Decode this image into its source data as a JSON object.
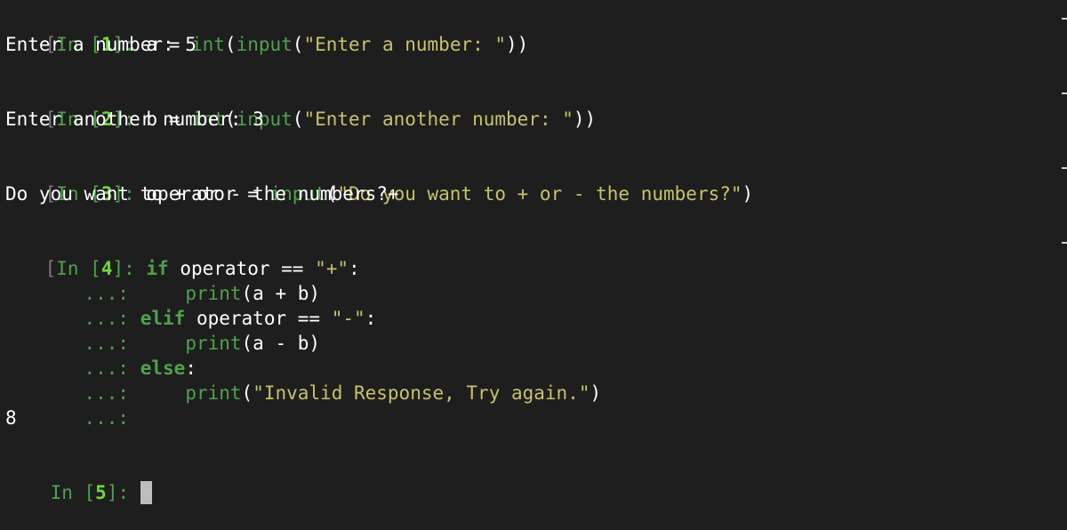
{
  "cell1": {
    "open": "[",
    "in": "In [",
    "n": "1",
    "close": "]: ",
    "v1": "a = ",
    "f1": "int",
    "p1": "(",
    "f2": "input",
    "p2": "(",
    "s1": "\"Enter a number: \"",
    "p3": "))",
    "output": "Enter a number: 5"
  },
  "cell2": {
    "open": "[",
    "in": "In [",
    "n": "2",
    "close": "]: ",
    "v1": "b = ",
    "f1": "int",
    "p1": "(",
    "f2": "input",
    "p2": "(",
    "s1": "\"Enter another number: \"",
    "p3": "))",
    "output": "Enter another number: 3"
  },
  "cell3": {
    "open": "[",
    "in": "In [",
    "n": "3",
    "close": "]: ",
    "v1": "operator = ",
    "f1": "input",
    "p1": "(",
    "s1": "\"Do you want to + or - the numbers?\"",
    "p2": ")",
    "output": "Do you want to + or - the numbers?+"
  },
  "cell4": {
    "open": "[",
    "in": "In [",
    "n": "4",
    "close": "]: ",
    "kw_if": "if",
    "if_rest": " operator == ",
    "if_str": "\"+\"",
    "colon": ":",
    "cont": "   ...: ",
    "indent": "    ",
    "print": "print",
    "ap": "(a + b)",
    "kw_elif": "elif",
    "elif_rest": " operator == ",
    "elif_str": "\"-\"",
    "am": "(a - b)",
    "kw_else": "else",
    "p_open": "(",
    "else_str": "\"Invalid Response, Try again.\"",
    "p_close": ")",
    "output": "8"
  },
  "cell5": {
    "in": "In [",
    "n": "5",
    "close": "]: "
  }
}
